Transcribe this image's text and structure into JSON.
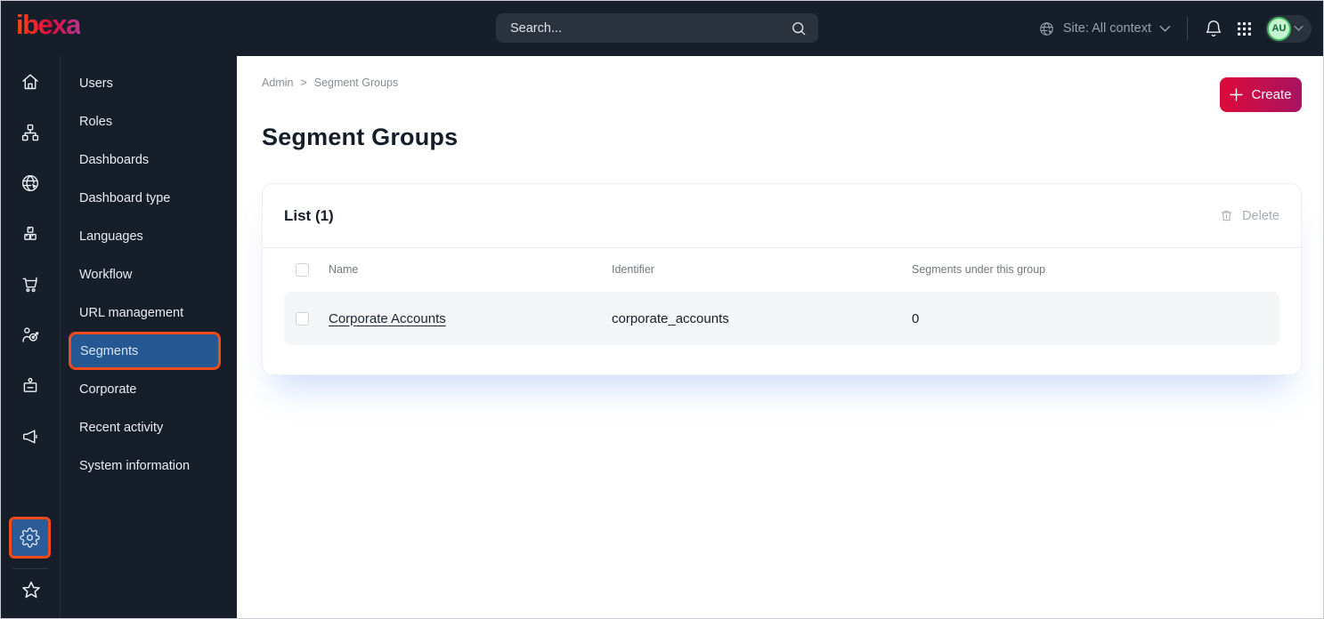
{
  "topbar": {
    "logo": "ibexa",
    "search_placeholder": "Search...",
    "site_context": "Site: All context",
    "avatar_initials": "AU"
  },
  "icon_rail": {
    "icons": [
      "home-icon",
      "content-tree-icon",
      "site-globe-icon",
      "products-icon",
      "cart-icon",
      "customers-target-icon",
      "corporate-badge-icon",
      "campaigns-megaphone-icon",
      "settings-gear-icon",
      "favorites-star-icon"
    ],
    "active_icon": "settings-gear-icon"
  },
  "menu": {
    "items": [
      {
        "label": "Users",
        "active": false
      },
      {
        "label": "Roles",
        "active": false
      },
      {
        "label": "Dashboards",
        "active": false
      },
      {
        "label": "Dashboard type",
        "active": false
      },
      {
        "label": "Languages",
        "active": false
      },
      {
        "label": "Workflow",
        "active": false
      },
      {
        "label": "URL management",
        "active": false
      },
      {
        "label": "Segments",
        "active": true
      },
      {
        "label": "Corporate",
        "active": false
      },
      {
        "label": "Recent activity",
        "active": false
      },
      {
        "label": "System information",
        "active": false
      }
    ]
  },
  "main": {
    "breadcrumb": [
      "Admin",
      "Segment Groups"
    ],
    "breadcrumb_separator": ">",
    "title": "Segment Groups",
    "create_label": "Create",
    "list": {
      "header": "List (1)",
      "delete_label": "Delete",
      "columns": [
        "Name",
        "Identifier",
        "Segments under this group"
      ],
      "rows": [
        {
          "name": "Corporate Accounts",
          "identifier": "corporate_accounts",
          "segments_count": "0"
        }
      ]
    }
  },
  "colors": {
    "topbar_bg": "#161e2a",
    "highlight_border": "#f34a1b",
    "active_item_bg": "#255892",
    "brand_gradient_start": "#dd0a3b",
    "brand_gradient_end": "#a81360",
    "avatar_green": "#43bb62",
    "row_bg": "#f4f5f7"
  }
}
